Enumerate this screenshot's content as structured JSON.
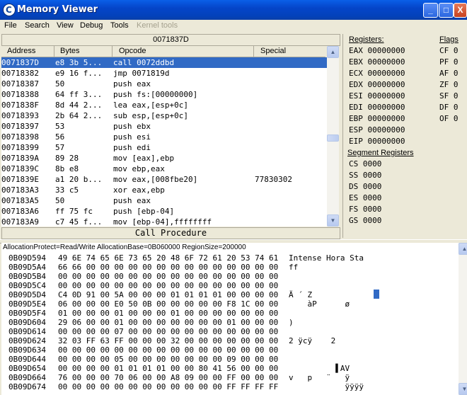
{
  "window": {
    "title": "Memory Viewer",
    "minimize": "_",
    "maximize": "□",
    "close": "X"
  },
  "menu": [
    "File",
    "Search",
    "View",
    "Debug",
    "Tools",
    "Kernel tools"
  ],
  "disasm": {
    "current_address": "0071837D",
    "columns": [
      "Address",
      "Bytes",
      "Opcode",
      "Special"
    ],
    "rows": [
      {
        "addr": "0071837D",
        "bytes": "e8 3b 5...",
        "op": "call 0072ddbd",
        "special": ""
      },
      {
        "addr": "00718382",
        "bytes": "e9 16 f...",
        "op": "jmp 0071819d",
        "special": ""
      },
      {
        "addr": "00718387",
        "bytes": "50",
        "op": "push eax",
        "special": ""
      },
      {
        "addr": "00718388",
        "bytes": "64 ff 3...",
        "op": "push fs:[00000000]",
        "special": ""
      },
      {
        "addr": "0071838F",
        "bytes": "8d 44 2...",
        "op": "lea eax,[esp+0c]",
        "special": ""
      },
      {
        "addr": "00718393",
        "bytes": "2b 64 2...",
        "op": "sub esp,[esp+0c]",
        "special": ""
      },
      {
        "addr": "00718397",
        "bytes": "53",
        "op": "push ebx",
        "special": ""
      },
      {
        "addr": "00718398",
        "bytes": "56",
        "op": "push esi",
        "special": ""
      },
      {
        "addr": "00718399",
        "bytes": "57",
        "op": "push edi",
        "special": ""
      },
      {
        "addr": "0071839A",
        "bytes": "89 28",
        "op": "mov [eax],ebp",
        "special": ""
      },
      {
        "addr": "0071839C",
        "bytes": "8b e8",
        "op": "mov ebp,eax",
        "special": ""
      },
      {
        "addr": "0071839E",
        "bytes": "a1 20 b...",
        "op": "mov eax,[008fbe20]",
        "special": "77830302"
      },
      {
        "addr": "007183A3",
        "bytes": "33 c5",
        "op": "xor eax,ebp",
        "special": ""
      },
      {
        "addr": "007183A5",
        "bytes": "50",
        "op": "push eax",
        "special": ""
      },
      {
        "addr": "007183A6",
        "bytes": "ff 75 fc",
        "op": "push [ebp-04]",
        "special": ""
      },
      {
        "addr": "007183A9",
        "bytes": "c7 45 f...",
        "op": "mov [ebp-04],ffffffff",
        "special": ""
      }
    ],
    "selected_index": 0,
    "status": "Call Procedure"
  },
  "registers": {
    "header": "Registers:",
    "flags_header": "Flags",
    "segment_header": "Segment Registers",
    "general": [
      {
        "name": "EAX",
        "value": "00000000"
      },
      {
        "name": "EBX",
        "value": "00000000"
      },
      {
        "name": "ECX",
        "value": "00000000"
      },
      {
        "name": "EDX",
        "value": "00000000"
      },
      {
        "name": "ESI",
        "value": "00000000"
      },
      {
        "name": "EDI",
        "value": "00000000"
      },
      {
        "name": "EBP",
        "value": "00000000"
      },
      {
        "name": "ESP",
        "value": "00000000"
      },
      {
        "name": "EIP",
        "value": "00000000"
      }
    ],
    "flags": [
      {
        "name": "CF",
        "value": "0"
      },
      {
        "name": "PF",
        "value": "0"
      },
      {
        "name": "AF",
        "value": "0"
      },
      {
        "name": "ZF",
        "value": "0"
      },
      {
        "name": "SF",
        "value": "0"
      },
      {
        "name": "DF",
        "value": "0"
      },
      {
        "name": "OF",
        "value": "0"
      }
    ],
    "segments": [
      {
        "name": "CS",
        "value": "0000"
      },
      {
        "name": "SS",
        "value": "0000"
      },
      {
        "name": "DS",
        "value": "0000"
      },
      {
        "name": "ES",
        "value": "0000"
      },
      {
        "name": "FS",
        "value": "0000"
      },
      {
        "name": "GS",
        "value": "0000"
      }
    ]
  },
  "hex": {
    "info": "AllocationProtect=Read/Write AllocationBase=0B060000 RegionSize=200000",
    "rows": [
      {
        "addr": "0B09D594",
        "bytes": "49 6E 74 65 6E 73 65 20 48 6F 72 61 20 53 74 61",
        "ascii": "Intense Hora Sta"
      },
      {
        "addr": "0B09D5A4",
        "bytes": "66 66 00 00 00 00 00 00 00 00 00 00 00 00 00 00",
        "ascii": "ff"
      },
      {
        "addr": "0B09D5B4",
        "bytes": "00 00 00 00 00 00 00 00 00 00 00 00 00 00 00 00",
        "ascii": ""
      },
      {
        "addr": "0B09D5C4",
        "bytes": "00 00 00 00 00 00 00 00 00 00 00 00 00 00 00 00",
        "ascii": ""
      },
      {
        "addr": "0B09D5D4",
        "bytes": "C4 0D 91 00 5A 00 00 00 01 01 01 01 00 00 00 00",
        "ascii": "Ä ´ Z"
      },
      {
        "addr": "0B09D5E4",
        "bytes": "06 00 00 00 E0 50 0B 00 00 00 00 00 F8 1C 00 00",
        "ascii": "    àP      ø"
      },
      {
        "addr": "0B09D5F4",
        "bytes": "01 00 00 00 01 00 00 00 01 00 00 00 00 00 00 00",
        "ascii": ""
      },
      {
        "addr": "0B09D604",
        "bytes": "29 06 00 00 01 00 00 00 00 00 00 00 01 00 00 00",
        "ascii": ")"
      },
      {
        "addr": "0B09D614",
        "bytes": "00 00 00 00 07 00 00 00 00 00 00 00 00 00 00 00",
        "ascii": ""
      },
      {
        "addr": "0B09D624",
        "bytes": "32 03 FF 63 FF 00 00 00 32 00 00 00 00 00 00 00",
        "ascii": "2 ÿcÿ    2"
      },
      {
        "addr": "0B09D634",
        "bytes": "00 00 00 00 00 00 00 00 00 00 00 00 00 00 00 00",
        "ascii": ""
      },
      {
        "addr": "0B09D644",
        "bytes": "00 00 00 00 05 00 00 00 00 00 00 00 09 00 00 00",
        "ascii": ""
      },
      {
        "addr": "0B09D654",
        "bytes": "00 00 00 00 01 01 01 01 00 00 80 41 56 00 00 00",
        "ascii": "          ▌AV"
      },
      {
        "addr": "0B09D664",
        "bytes": "76 00 00 00 70 06 00 00 A8 09 00 00 FF 00 00 00",
        "ascii": "v   p   ¨   ÿ"
      },
      {
        "addr": "0B09D674",
        "bytes": "00 00 00 00 00 00 00 00 00 00 00 00 FF FF FF FF",
        "ascii": "            ÿÿÿÿ"
      }
    ]
  },
  "colors": {
    "selection": "#316ac5",
    "titlebar": "#0545c9",
    "face": "#ece9d8"
  }
}
